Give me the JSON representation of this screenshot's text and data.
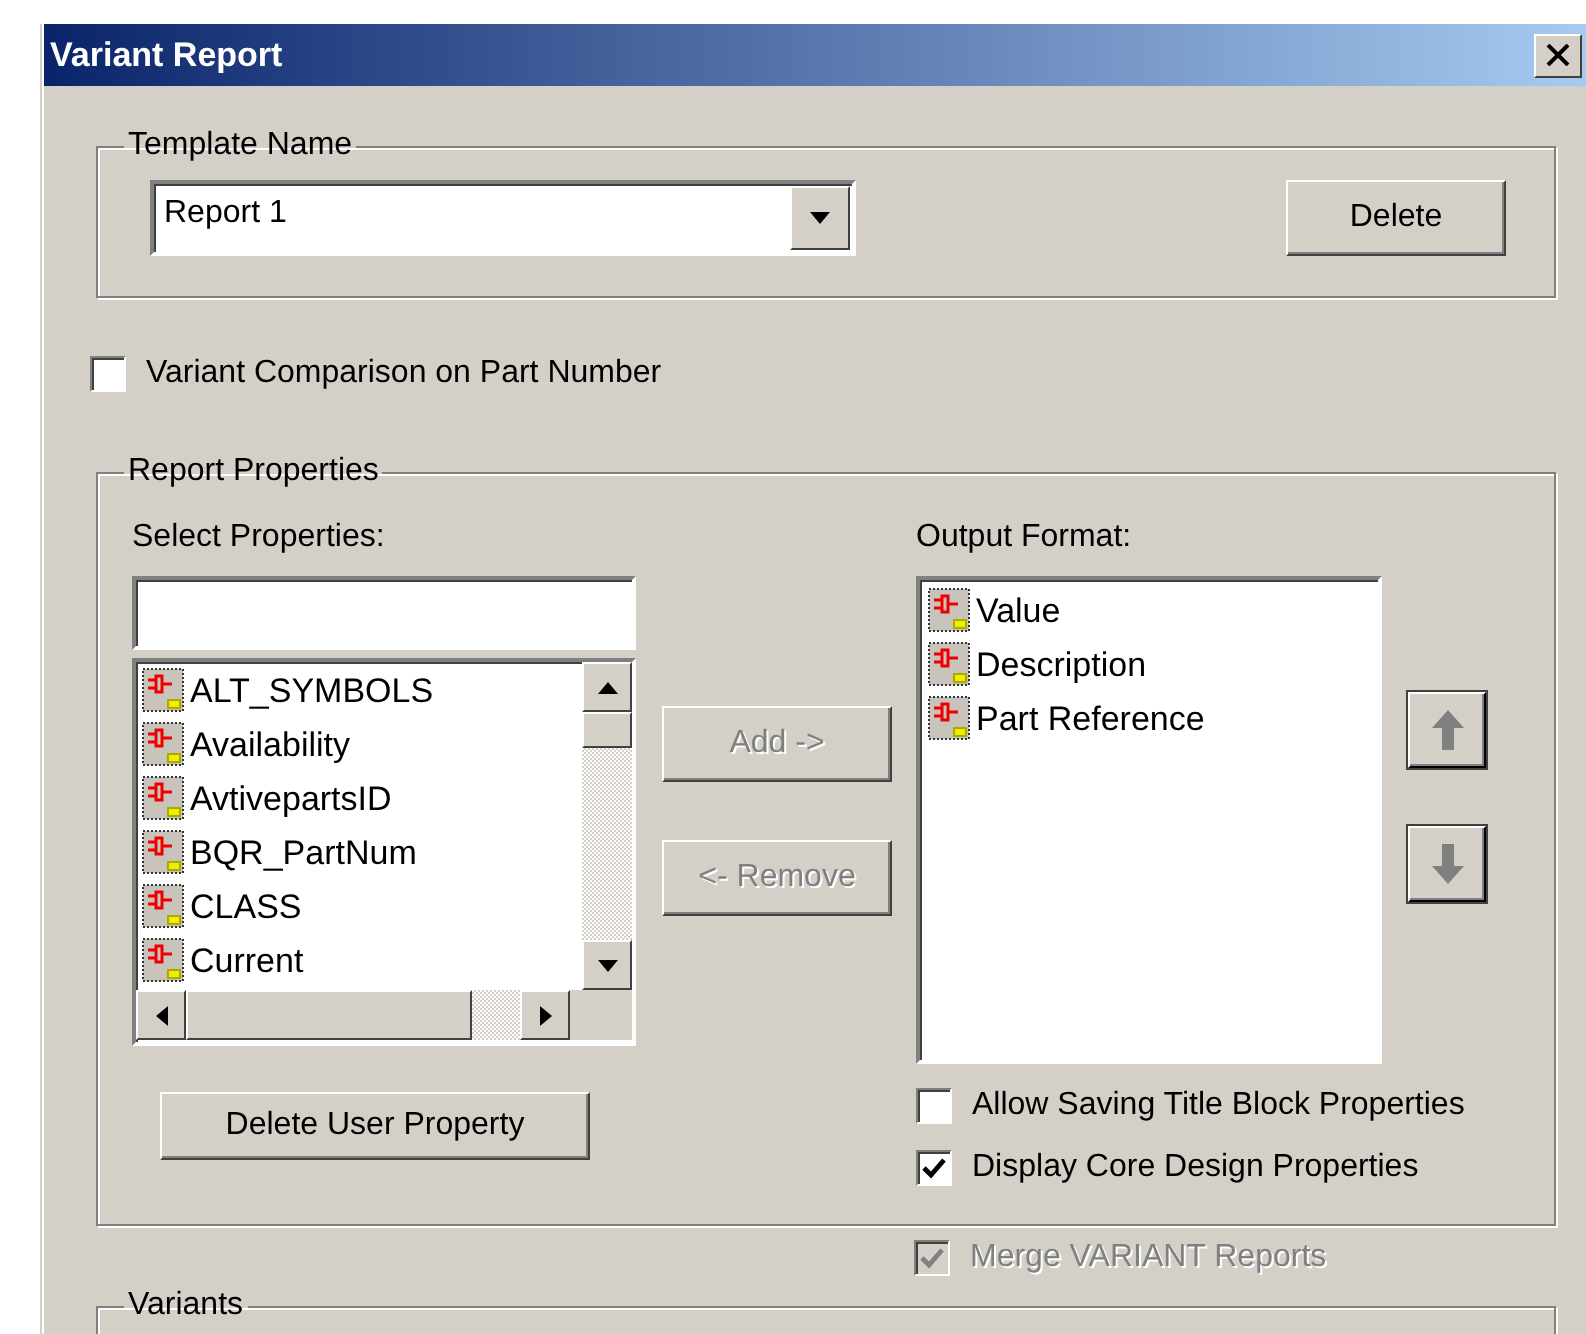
{
  "window": {
    "title": "Variant Report"
  },
  "template_name": {
    "label": "Template Name",
    "value": "Report 1",
    "delete_button": "Delete"
  },
  "variant_comparison": {
    "label": "Variant Comparison on Part Number",
    "checked": false
  },
  "report_properties": {
    "label": "Report Properties",
    "select_label": "Select Properties:",
    "properties": [
      "ALT_SYMBOLS",
      "Availability",
      "AvtivepartsID",
      "BQR_PartNum",
      "CLASS",
      "Current"
    ],
    "add_button": {
      "label": "Add ->",
      "disabled": true
    },
    "remove_button": {
      "label": "<- Remove",
      "disabled": true
    },
    "output_label": "Output Format:",
    "output_items": [
      "Value",
      "Description",
      "Part Reference"
    ],
    "move_up_disabled": true,
    "move_down_disabled": true,
    "options": [
      {
        "label": "Allow Saving Title Block Properties",
        "checked": false,
        "disabled": false
      },
      {
        "label": "Display Core Design Properties",
        "checked": true,
        "disabled": false
      }
    ],
    "delete_user_property_button": "Delete User Property"
  },
  "merge": {
    "label": "Merge VARIANT Reports",
    "checked": true,
    "disabled": true
  },
  "variants": {
    "label": "Variants"
  }
}
